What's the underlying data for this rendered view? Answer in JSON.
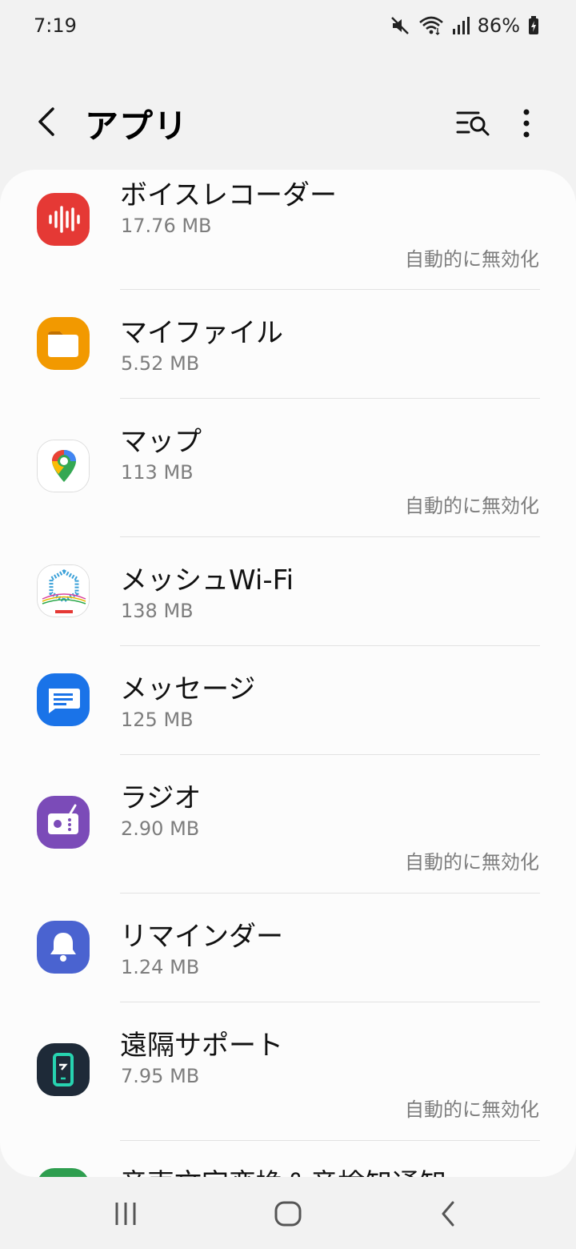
{
  "status_bar": {
    "time": "7:19",
    "battery": "86%",
    "icons": [
      "mute-icon",
      "wifi-icon",
      "signal-icon",
      "battery-charging-icon"
    ]
  },
  "header": {
    "title": "アプリ",
    "back_icon": "back-arrow-icon",
    "search_icon": "filter-search-icon",
    "more_icon": "more-vertical-icon"
  },
  "apps": [
    {
      "name": "ボイスレコーダー",
      "size": "17.76 MB",
      "status": "自動的に無効化",
      "icon": "voice-recorder-icon",
      "color": "#e53935"
    },
    {
      "name": "マイファイル",
      "size": "5.52 MB",
      "status": "",
      "icon": "my-files-icon",
      "color": "#f29900"
    },
    {
      "name": "マップ",
      "size": "113 MB",
      "status": "自動的に無効化",
      "icon": "maps-icon",
      "color": "#ffffff"
    },
    {
      "name": "メッシュWi-Fi",
      "size": "138 MB",
      "status": "",
      "icon": "mesh-wifi-icon",
      "color": "#ffffff"
    },
    {
      "name": "メッセージ",
      "size": "125 MB",
      "status": "",
      "icon": "messages-icon",
      "color": "#1a73e8"
    },
    {
      "name": "ラジオ",
      "size": "2.90 MB",
      "status": "自動的に無効化",
      "icon": "radio-icon",
      "color": "#7b4bb8"
    },
    {
      "name": "リマインダー",
      "size": "1.24 MB",
      "status": "",
      "icon": "reminder-icon",
      "color": "#4a63d0"
    },
    {
      "name": "遠隔サポート",
      "size": "7.95 MB",
      "status": "自動的に無効化",
      "icon": "remote-support-icon",
      "color": "#1e2a38"
    },
    {
      "name": "音声文字変換＆音検知通知",
      "size": "",
      "status": "",
      "icon": "live-transcribe-icon",
      "color": "#2e9e4f"
    }
  ],
  "nav_bar": {
    "recents_icon": "recents-icon",
    "home_icon": "home-icon",
    "back_icon": "nav-back-icon"
  }
}
